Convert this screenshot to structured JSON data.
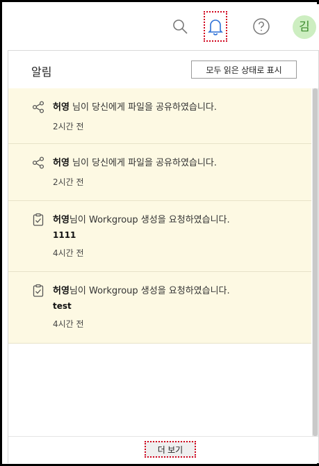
{
  "topbar": {
    "icons": {
      "search": "search-icon",
      "bell": "bell-icon",
      "help": "help-icon"
    },
    "avatar_initial": "김",
    "avatar_color": "#cdeec1",
    "accent_bell": "#2b6fd6"
  },
  "panel": {
    "title": "알림",
    "mark_all_read": "모두 읽은 상태로 표시",
    "more_label": "더 보기",
    "items": [
      {
        "icon": "share-icon",
        "sender": "허영",
        "message": " 님이 당신에게 파일을 공유하였습니다.",
        "detail": "",
        "time": "2시간 전"
      },
      {
        "icon": "share-icon",
        "sender": "허영",
        "message": " 님이 당신에게 파일을 공유하였습니다.",
        "detail": "",
        "time": "2시간 전"
      },
      {
        "icon": "clipboard-check-icon",
        "sender": "허영",
        "message": "님이 Workgroup 생성을 요청하였습니다.",
        "detail": "1111",
        "time": "4시간 전"
      },
      {
        "icon": "clipboard-check-icon",
        "sender": "허영",
        "message": "님이 Workgroup 생성을 요청하였습니다.",
        "detail": "test",
        "time": "4시간 전"
      }
    ]
  }
}
